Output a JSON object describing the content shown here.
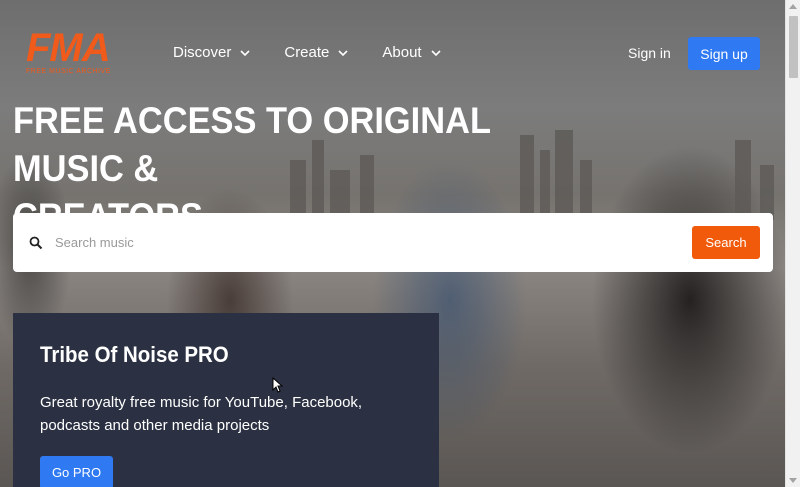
{
  "brand": {
    "logo_text": "FMA",
    "logo_tagline": "FREE MUSIC ARCHIVE",
    "accent_color": "#f05a1a"
  },
  "nav": {
    "items": [
      {
        "label": "Discover",
        "icon": "chevron-down-icon"
      },
      {
        "label": "Create",
        "icon": "chevron-down-icon"
      },
      {
        "label": "About",
        "icon": "chevron-down-icon"
      }
    ],
    "signin_label": "Sign in",
    "signup_label": "Sign up"
  },
  "hero": {
    "headline_line1": "FREE ACCESS TO ORIGINAL MUSIC &",
    "headline_line2": "CREATORS"
  },
  "search": {
    "placeholder": "Search music",
    "button_label": "Search",
    "icon": "search-icon"
  },
  "promo": {
    "title": "Tribe Of Noise PRO",
    "text": "Great royalty free music for YouTube, Facebook, podcasts and other media projects",
    "button_label": "Go PRO"
  },
  "colors": {
    "primary_blue": "#2f7af2",
    "search_orange": "#f05a0a",
    "promo_bg": "#2b3142"
  }
}
